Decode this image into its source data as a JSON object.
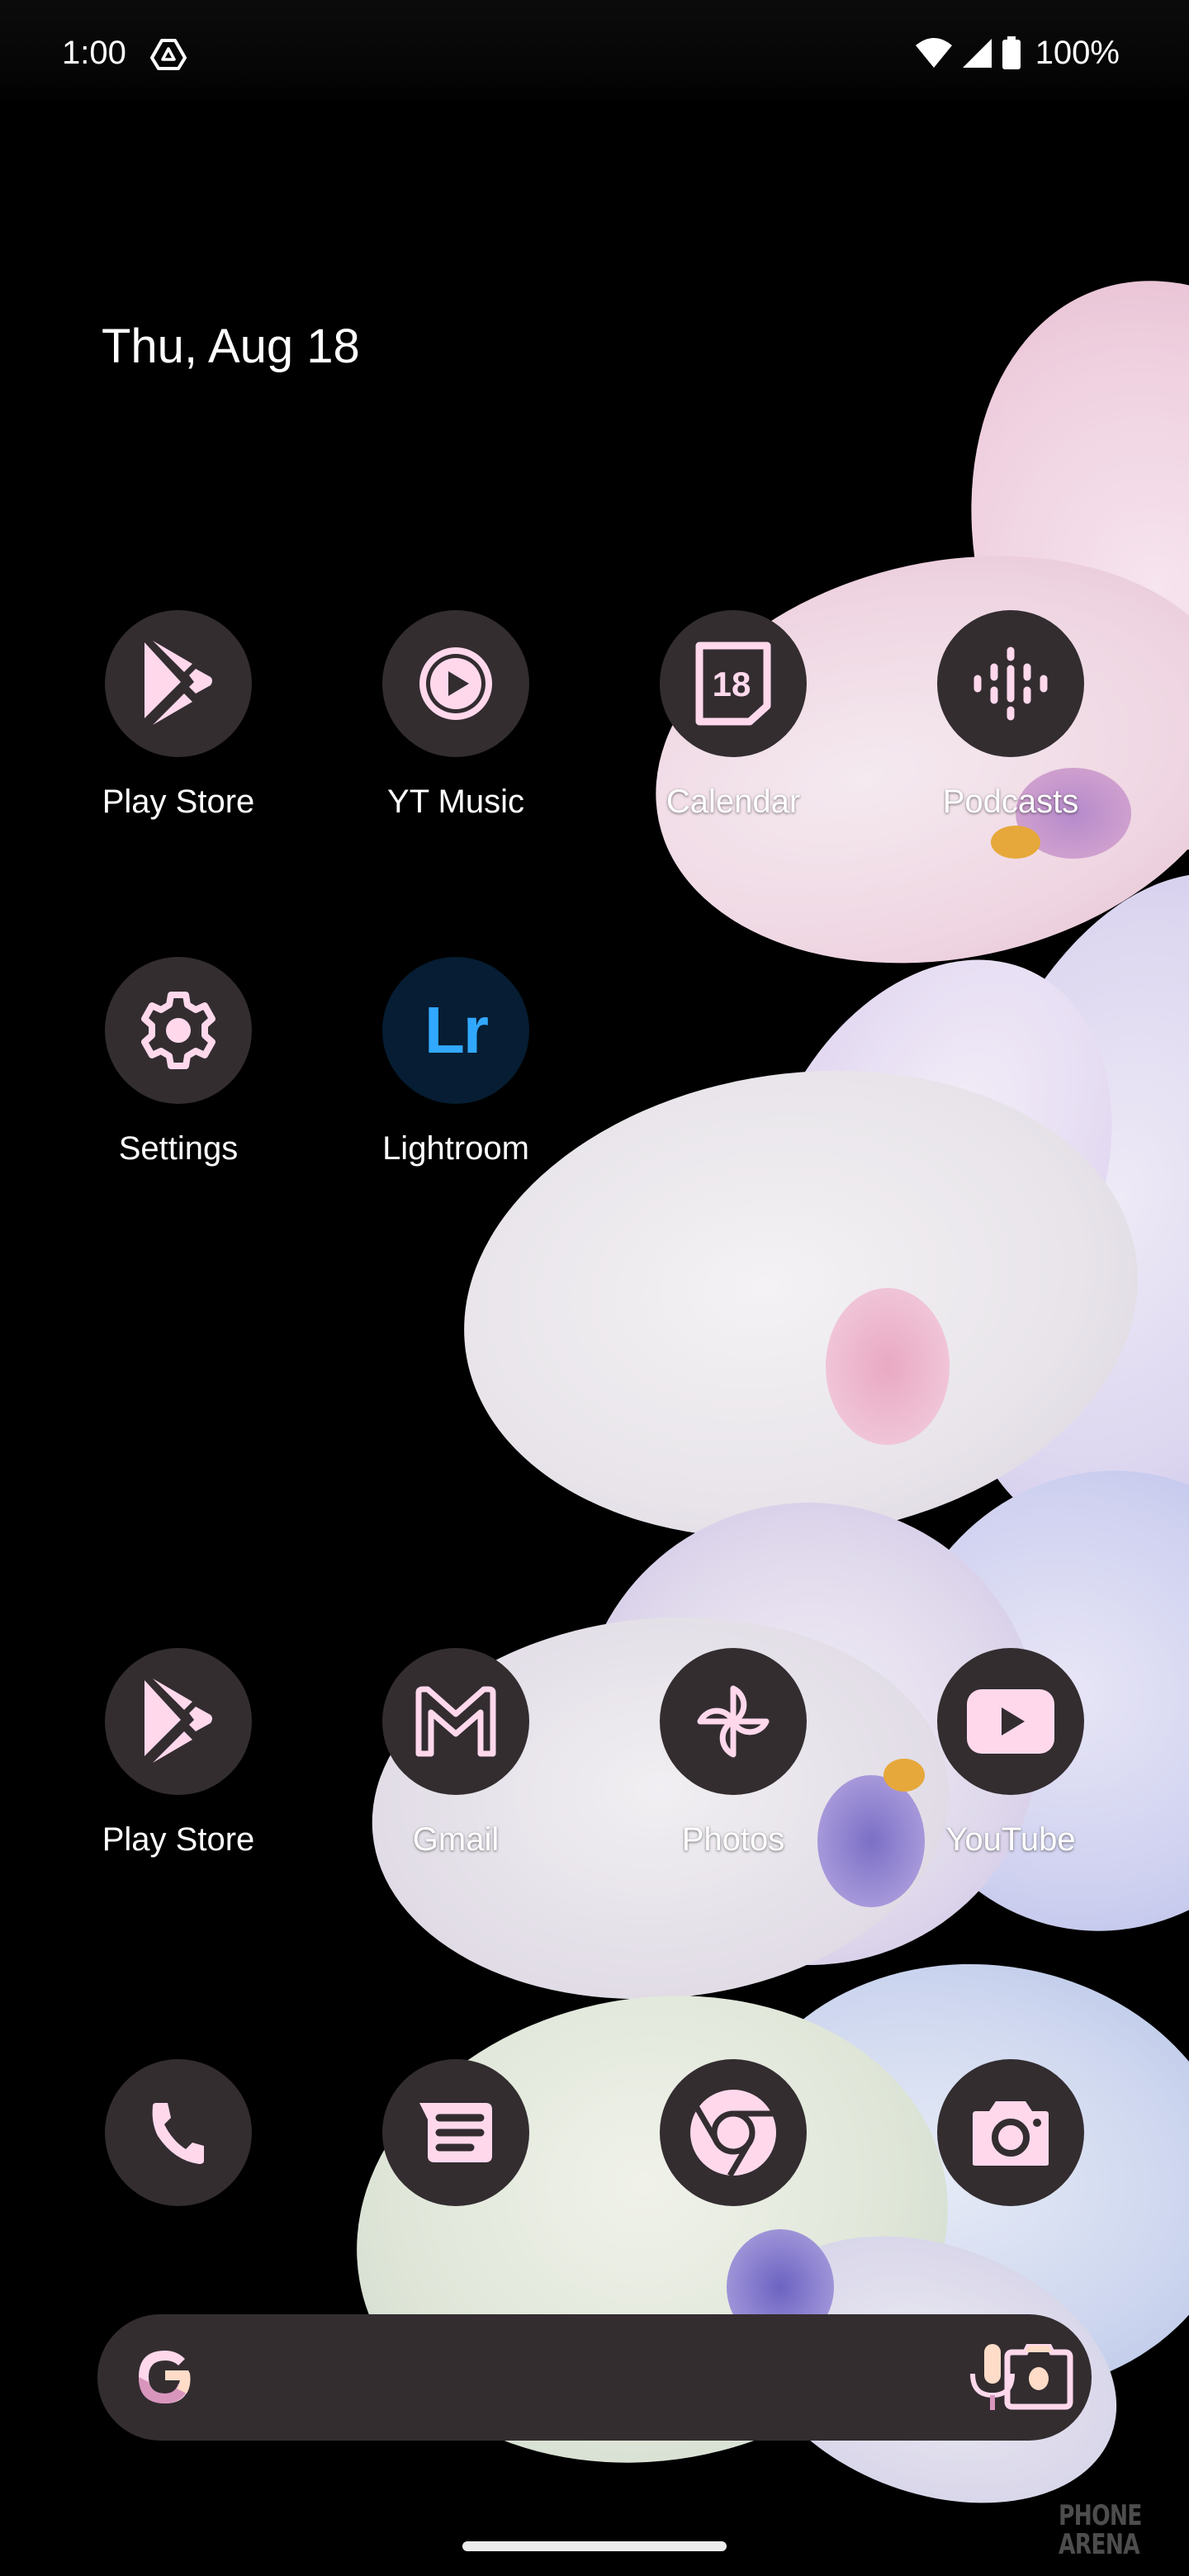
{
  "status_bar": {
    "time": "1:00",
    "notification_icon": "drive-triangle-icon",
    "wifi_icon": "wifi-icon",
    "signal_icon": "cell-signal-icon",
    "battery_icon": "battery-full-icon",
    "battery_percent": "100%"
  },
  "date_widget": {
    "date": "Thu, Aug 18"
  },
  "colors": {
    "icon_bg": "#332d30",
    "icon_fg": "#ffd8ec",
    "lightroom_bg": "#061d33",
    "lightroom_fg": "#31a8ff",
    "label": "#ffffff",
    "background": "#000000"
  },
  "home_apps": [
    {
      "label": "Play Store",
      "icon": "play-store-icon"
    },
    {
      "label": "YT Music",
      "icon": "yt-music-icon"
    },
    {
      "label": "Calendar",
      "icon": "calendar-icon",
      "icon_text": "18"
    },
    {
      "label": "Podcasts",
      "icon": "podcasts-icon"
    },
    {
      "label": "Settings",
      "icon": "settings-gear-icon"
    },
    {
      "label": "Lightroom",
      "icon": "lightroom-icon",
      "icon_text": "Lr"
    },
    {
      "label": "Play Store",
      "icon": "play-store-icon"
    },
    {
      "label": "Gmail",
      "icon": "gmail-icon"
    },
    {
      "label": "Photos",
      "icon": "photos-pinwheel-icon"
    },
    {
      "label": "YouTube",
      "icon": "youtube-icon"
    }
  ],
  "dock": [
    {
      "app": "Phone",
      "icon": "phone-icon"
    },
    {
      "app": "Messages",
      "icon": "messages-icon"
    },
    {
      "app": "Chrome",
      "icon": "chrome-icon"
    },
    {
      "app": "Camera",
      "icon": "camera-icon"
    }
  ],
  "search_bar": {
    "logo": "google-g-icon",
    "mic": "microphone-icon",
    "lens": "google-lens-icon"
  },
  "watermark": {
    "line1": "PHONE",
    "line2": "ARENA"
  }
}
